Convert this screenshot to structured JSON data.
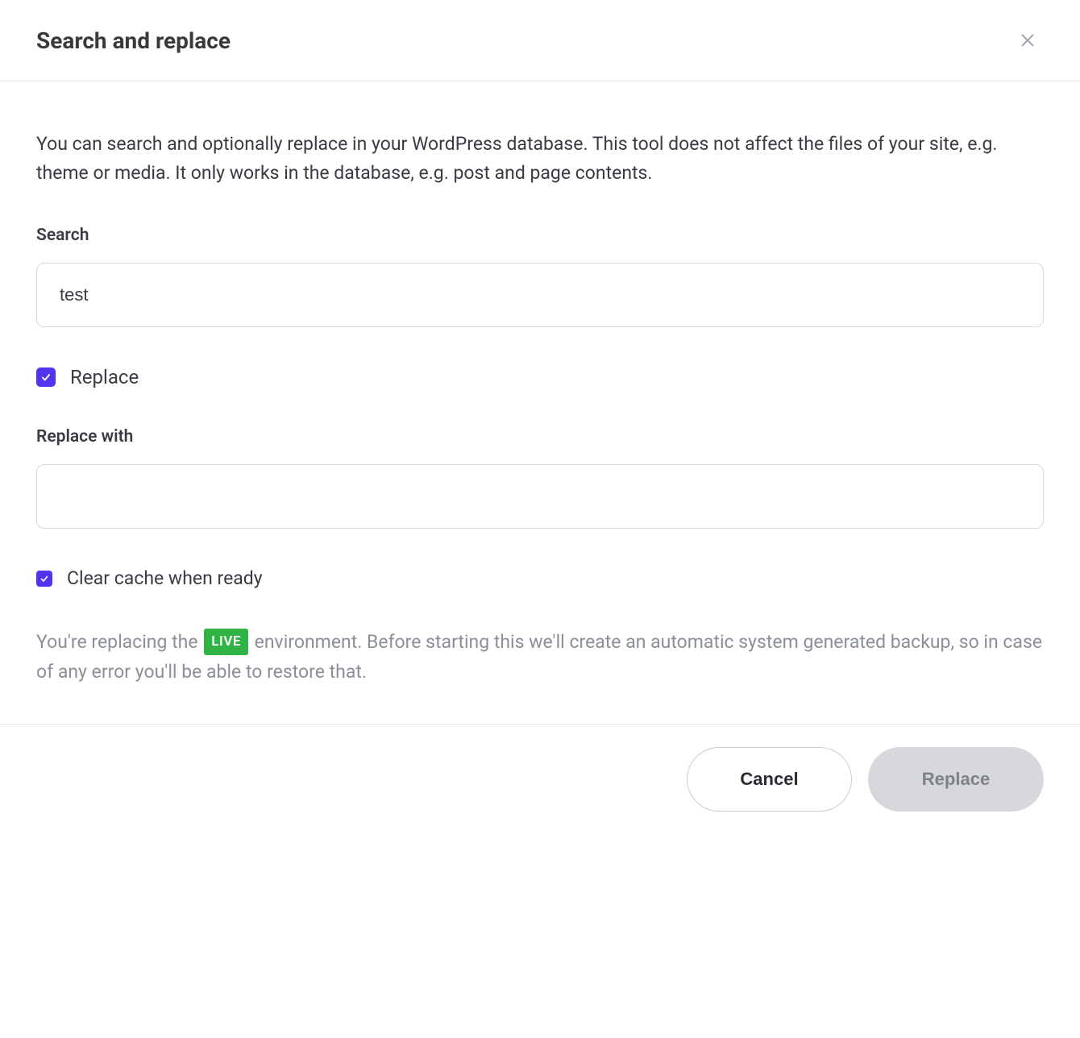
{
  "dialog": {
    "title": "Search and replace",
    "description": "You can search and optionally replace in your WordPress database. This tool does not affect the files of your site, e.g. theme or media. It only works in the database, e.g. post and page contents."
  },
  "fields": {
    "search_label": "Search",
    "search_value": "test",
    "replace_checkbox_label": "Replace",
    "replace_checkbox_checked": true,
    "replace_with_label": "Replace with",
    "replace_with_value": "",
    "clear_cache_label": "Clear cache when ready",
    "clear_cache_checked": true
  },
  "note": {
    "prefix": "You're replacing the ",
    "env_badge": "LIVE",
    "suffix": " environment. Before starting this we'll create an automatic system generated backup, so in case of any error you'll be able to restore that."
  },
  "buttons": {
    "cancel": "Cancel",
    "replace": "Replace"
  }
}
